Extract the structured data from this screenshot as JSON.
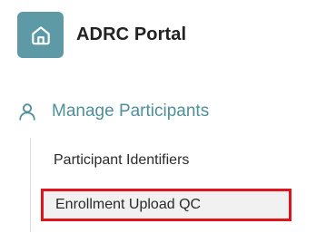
{
  "brand": {
    "logo_icon": "home-icon",
    "title": "ADRC Portal",
    "logo_color": "#5d9aa5"
  },
  "nav": {
    "section": {
      "icon": "user-icon",
      "label": "Manage Participants",
      "color": "#4f8f9b"
    },
    "items": [
      {
        "label": "Participant Identifiers",
        "active": false
      },
      {
        "label": "Enrollment Upload QC",
        "active": true,
        "highlight_color": "#e0141a"
      }
    ]
  }
}
